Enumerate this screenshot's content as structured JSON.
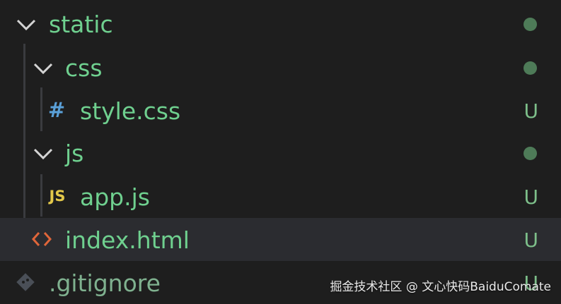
{
  "explorer": {
    "items": [
      {
        "label": "static",
        "type": "folder",
        "expanded": true,
        "status": "dot"
      },
      {
        "label": "css",
        "type": "folder",
        "expanded": true,
        "status": "dot"
      },
      {
        "label": "style.css",
        "type": "file",
        "icon": "#",
        "status": "U"
      },
      {
        "label": "js",
        "type": "folder",
        "expanded": true,
        "status": "dot"
      },
      {
        "label": "app.js",
        "type": "file",
        "icon": "JS",
        "status": "U"
      },
      {
        "label": "index.html",
        "type": "file",
        "icon": "<>",
        "status": "U",
        "selected": true
      },
      {
        "label": ".gitignore",
        "type": "file",
        "icon": "git-diamond",
        "status": "U"
      }
    ]
  },
  "watermark": "掘金技术社区 @ 文心快码BaiduComate",
  "colors": {
    "background": "#1e1e1e",
    "selected_row": "#2b2c30",
    "label_green": "#6fd08f",
    "status_green": "#7dbf8a",
    "dot_green": "#4e7b58",
    "css_icon": "#5aa0d8",
    "js_icon": "#e3c84a",
    "html_icon": "#e0663a"
  }
}
